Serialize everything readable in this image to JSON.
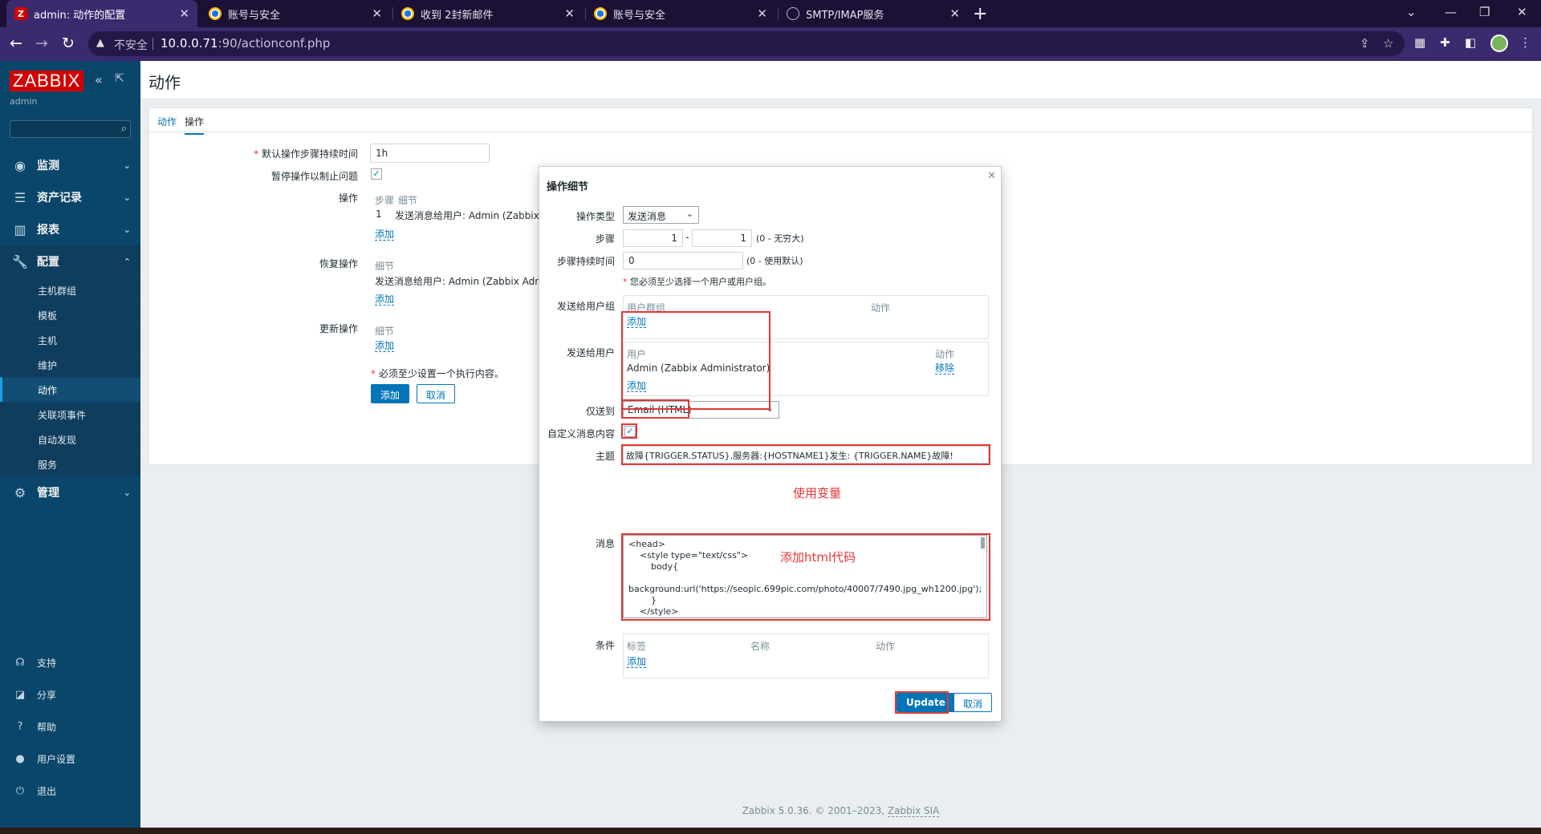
{
  "browser": {
    "tabs": [
      {
        "title": "admin: 动作的配置",
        "active": true,
        "icon": "zabbix-z-icon"
      },
      {
        "title": "账号与安全",
        "active": false,
        "icon": "google-icon"
      },
      {
        "title": "收到 2封新邮件",
        "active": false,
        "icon": "google-icon"
      },
      {
        "title": "账号与安全",
        "active": false,
        "icon": "google-icon"
      },
      {
        "title": "SMTP/IMAP服务",
        "active": false,
        "icon": "globe-icon"
      }
    ],
    "insecure_label": "不安全",
    "url_host": "10.0.0.71",
    "url_rest": ":90/actionconf.php"
  },
  "sidebar": {
    "logo": "ZABBIX",
    "user": "admin",
    "menu": [
      {
        "label": "监测",
        "icon": "eye-icon"
      },
      {
        "label": "资产记录",
        "icon": "list-icon"
      },
      {
        "label": "报表",
        "icon": "chart-icon"
      },
      {
        "label": "配置",
        "icon": "wrench-icon"
      }
    ],
    "submenu": [
      "主机群组",
      "模板",
      "主机",
      "维护",
      "动作",
      "关联项事件",
      "自动发现",
      "服务"
    ],
    "admin": {
      "label": "管理",
      "icon": "gear-icon"
    },
    "bottom": [
      {
        "label": "支持",
        "icon": "headset-icon"
      },
      {
        "label": "分享",
        "icon": "share-icon"
      },
      {
        "label": "帮助",
        "icon": "help-icon"
      },
      {
        "label": "用户设置",
        "icon": "user-icon"
      },
      {
        "label": "退出",
        "icon": "power-icon"
      }
    ]
  },
  "page": {
    "title": "动作",
    "tabs": [
      "动作",
      "操作"
    ],
    "default_duration_label": "默认操作步骤持续时间",
    "default_duration_value": "1h",
    "pause_label": "暂停操作以制止问题",
    "operations_label": "操作",
    "ops_hdr_steps": "步骤",
    "ops_hdr_details": "细节",
    "ops_row_step": "1",
    "ops_row_detail": "发送消息给用户: Admin (Zabbix A",
    "add": "添加",
    "recovery_label": "恢复操作",
    "recovery_hdr": "细节",
    "recovery_row": "发送消息给用户: Admin (Zabbix Admin",
    "update_label": "更新操作",
    "update_hdr": "细节",
    "required_note": "必须至少设置一个执行内容。",
    "add_button": "添加",
    "cancel_button": "取消"
  },
  "modal": {
    "title": "操作细节",
    "op_type_label": "操作类型",
    "op_type_value": "发送消息",
    "steps_label": "步骤",
    "step_from": "1",
    "step_to": "1",
    "steps_hint": "(0 - 无穷大)",
    "step_duration_label": "步骤持续时间",
    "step_duration_value": "0",
    "step_duration_hint": "(0 - 使用默认)",
    "required_note": "您必须至少选择一个用户或用户组。",
    "send_groups_label": "发送给用户组",
    "groups_hdr_group": "用户群组",
    "groups_hdr_action": "动作",
    "groups_add": "添加",
    "send_users_label": "发送给用户",
    "users_hdr_user": "用户",
    "users_hdr_action": "动作",
    "users_row": "Admin (Zabbix Administrator)",
    "users_remove": "移除",
    "users_add": "添加",
    "send_only_label": "仅送到",
    "send_only_value": "Email (HTML)",
    "custom_msg_label": "自定义消息内容",
    "subject_label": "主题",
    "subject_value": "故障{TRIGGER.STATUS},服务器:{HOSTNAME1}发生: {TRIGGER.NAME}故障!",
    "message_label": "消息",
    "message_value": "<head>\n    <style type=\"text/css\">\n        body{\n\nbackground:url('https://seopic.699pic.com/photo/40007/7490.jpg_wh1200.jpg');\n        }\n    </style>\n</head>",
    "conditions_label": "条件",
    "cond_hdr_label": "标签",
    "cond_hdr_name": "名称",
    "cond_hdr_action": "动作",
    "cond_add": "添加",
    "update_button": "Update",
    "cancel_button": "取消"
  },
  "annotations": {
    "use_variables": "使用变量",
    "add_html": "添加html代码"
  },
  "footer": {
    "text": "Zabbix 5.0.36. © 2001–2023, ",
    "link": "Zabbix SIA"
  },
  "colors": {
    "sidebar": "#0a466a",
    "accent": "#0275b8",
    "annotation_red": "#e33734",
    "browser_frame": "#3b2a6e"
  }
}
